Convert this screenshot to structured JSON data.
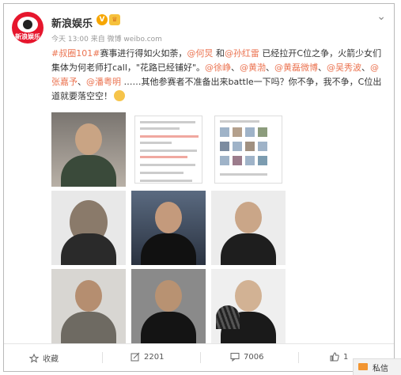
{
  "post": {
    "account_name": "新浪娱乐",
    "avatar_text": "新浪娱乐",
    "verified_mark": "V",
    "timestamp": "今天 13:00",
    "source": "来自 微博 weibo.com",
    "dropdown_icon": "chevron-down-icon",
    "text_segments": [
      {
        "text": "#叔圈101#",
        "link": true
      },
      {
        "text": "赛事进行得如火如荼，",
        "link": false
      },
      {
        "text": "@何炅",
        "link": true
      },
      {
        "text": " 和",
        "link": false
      },
      {
        "text": "@孙红雷",
        "link": true
      },
      {
        "text": " 已经拉开C位之争，火箭少女们集体为何老师打call，\"花路已经铺好\"。",
        "link": false
      },
      {
        "text": "@徐峥",
        "link": true
      },
      {
        "text": "、",
        "link": false
      },
      {
        "text": "@黄渤",
        "link": true
      },
      {
        "text": "、",
        "link": false
      },
      {
        "text": "@黄磊微博",
        "link": true
      },
      {
        "text": "、",
        "link": false
      },
      {
        "text": "@吴秀波",
        "link": true
      },
      {
        "text": "、",
        "link": false
      },
      {
        "text": "@张嘉予",
        "link": true
      },
      {
        "text": "、",
        "link": false
      },
      {
        "text": "@潘粤明",
        "link": true
      },
      {
        "text": " ……其他参赛者不准备出来battle一下吗？你不争，我不争，C位出道就要落空空！",
        "link": false
      }
    ]
  },
  "toolbar": {
    "favorite_label": "收藏",
    "repost_count": "2201",
    "comment_count": "7006",
    "like_count": "1"
  },
  "pm_label": "私信",
  "colors": {
    "accent": "#eb7350",
    "brand_red": "#e6162d"
  }
}
